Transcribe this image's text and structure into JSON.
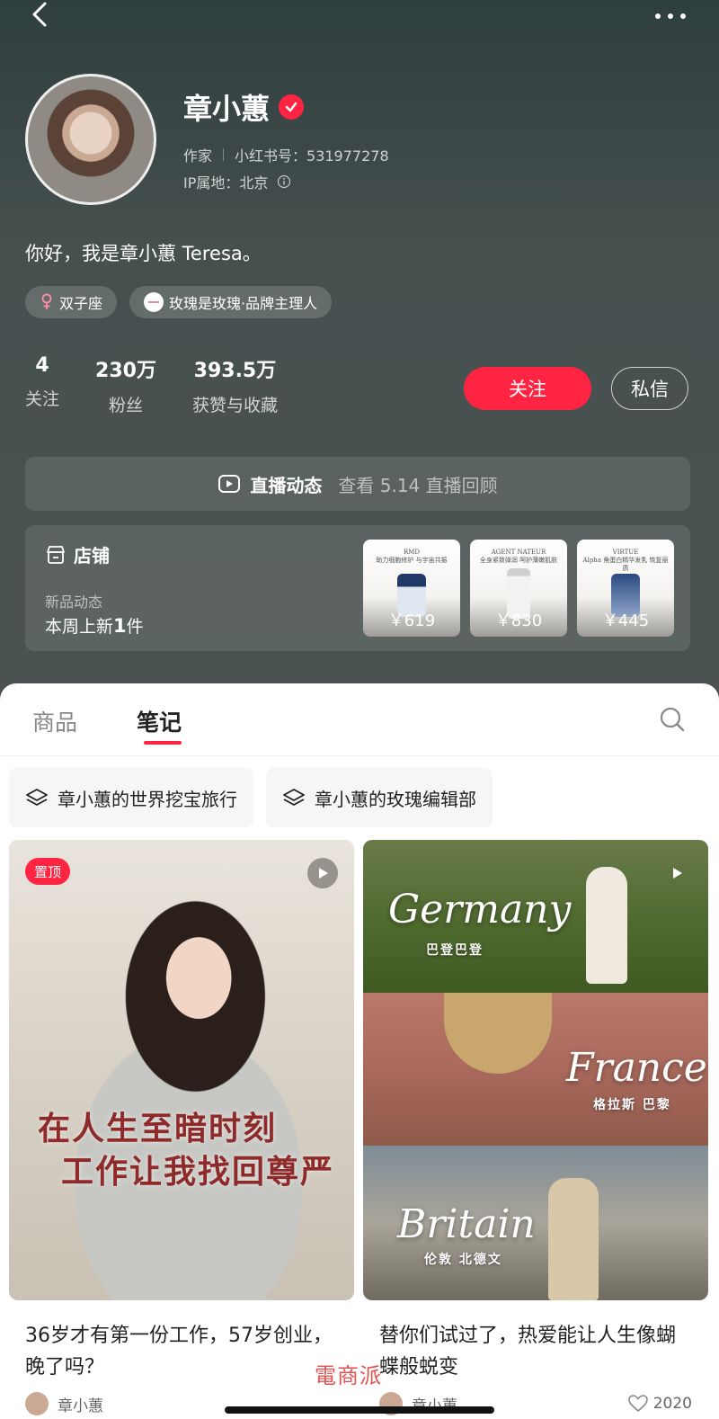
{
  "profile": {
    "name": "章小蕙",
    "occupation": "作家",
    "redbook_id": "小红书号：531977278",
    "ip_location": "IP属地：北京",
    "bio": "你好，我是章小蕙 Teresa。",
    "tags": [
      {
        "label": "双子座",
        "icon": "female-icon"
      },
      {
        "label": "玫瑰是玫瑰·品牌主理人",
        "icon": "brand-icon"
      }
    ],
    "stats": [
      {
        "num": "4",
        "label": "关注"
      },
      {
        "num": "230万",
        "label": "粉丝"
      },
      {
        "num": "393.5万",
        "label": "获赞与收藏"
      }
    ],
    "follow_label": "关注",
    "message_label": "私信"
  },
  "live": {
    "title": "直播动态",
    "subtitle": "查看 5.14 直播回顾"
  },
  "shop": {
    "title": "店铺",
    "sub": "新品动态",
    "new_prefix": "本周上新",
    "new_count": "1",
    "new_suffix": "件",
    "products": [
      {
        "brand": "RMD",
        "text": "助力细胞修护 与宇宙共振",
        "price": "￥619"
      },
      {
        "brand": "AGENT NATEUR",
        "text": "全身紧致弹润 呵护薄嫩肌肤",
        "price": "￥830"
      },
      {
        "brand": "VIRTUE",
        "text": "Alpha 角蛋白精华发乳 恢复丽质",
        "price": "￥445"
      }
    ]
  },
  "tabs": [
    {
      "label": "商品",
      "active": false
    },
    {
      "label": "笔记",
      "active": true
    }
  ],
  "albums": [
    {
      "label": "章小蕙的世界挖宝旅行"
    },
    {
      "label": "章小蕙的玫瑰编辑部"
    }
  ],
  "notes": [
    {
      "pin": "置顶",
      "overlay_line1": "在人生至暗时刻",
      "overlay_line2": "工作让我找回尊严",
      "title": "36岁才有第一份工作，57岁创业，晚了吗？",
      "author": "章小蕙"
    },
    {
      "panels": [
        {
          "title": "Germany",
          "sub": "巴登巴登"
        },
        {
          "title": "France",
          "sub": "格拉斯 巴黎"
        },
        {
          "title": "Britain",
          "sub": "伦敦 北德文"
        }
      ],
      "title": "替你们试过了，热爱能让人生像蝴蝶般蜕变",
      "author": "章小蕙",
      "likes": "2020"
    }
  ],
  "watermark": "電商派"
}
